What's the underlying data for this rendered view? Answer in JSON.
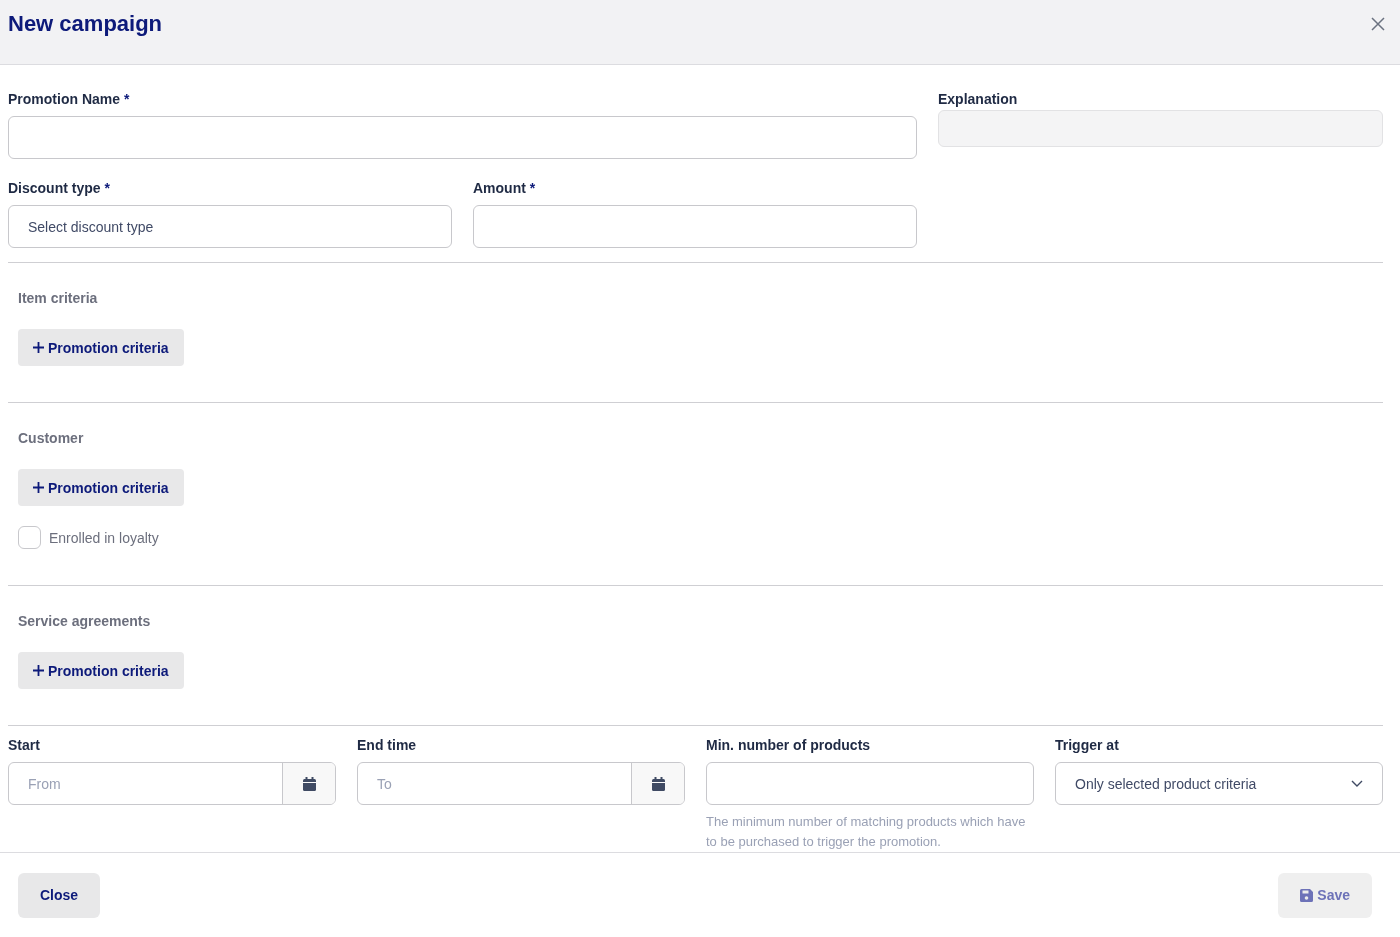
{
  "window": {
    "title": "New campaign"
  },
  "top_fields": [
    {
      "label": "Promotion Name",
      "required_mark": "*",
      "kind": "input"
    },
    {
      "label": "Discount type",
      "required_mark": "*",
      "kind": "select",
      "placeholder": "Select discount type"
    },
    {
      "label": "Amount",
      "required_mark": "*",
      "kind": "input"
    }
  ],
  "explanation": {
    "label": "Explanation",
    "disabled": true
  },
  "sections": [
    {
      "title": "Item criteria",
      "add_button": "Promotion criteria"
    },
    {
      "title": "Customer",
      "add_button": "Promotion criteria",
      "checkbox": {
        "label": "Enrolled in loyalty",
        "checked": false
      }
    },
    {
      "title": "Service agreements",
      "add_button": "Promotion criteria"
    }
  ],
  "bottom_fields": [
    {
      "label": "Start",
      "kind": "date",
      "placeholder": "From"
    },
    {
      "label": "End time",
      "kind": "date",
      "placeholder": "To"
    },
    {
      "label": "Min. number of products",
      "kind": "input",
      "hint": "The minimum number of matching products which have to be purchased to trigger the promotion."
    },
    {
      "label": "Trigger at",
      "kind": "dropdown",
      "value": "Only selected product criteria"
    }
  ],
  "footer": {
    "close": {
      "label": "Close",
      "disabled": false
    },
    "save": {
      "label": "Save",
      "disabled": true
    }
  }
}
